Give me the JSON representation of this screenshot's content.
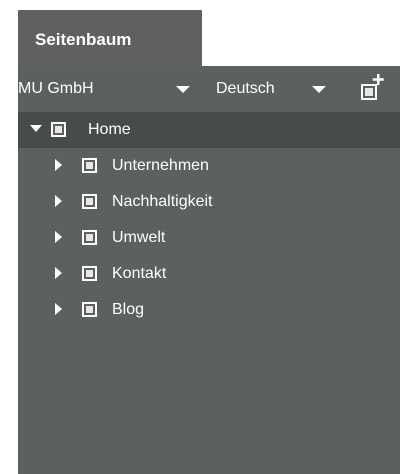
{
  "panel": {
    "title": "Seitenbaum"
  },
  "toolbar": {
    "company": "MU GmbH",
    "language": "Deutsch",
    "add_page_icon": "add-page-icon"
  },
  "tree": {
    "root": {
      "label": "Home",
      "expanded": true,
      "selected": true
    },
    "children": [
      {
        "label": "Unternehmen",
        "expanded": false
      },
      {
        "label": "Nachhaltigkeit",
        "expanded": false
      },
      {
        "label": "Umwelt",
        "expanded": false
      },
      {
        "label": "Kontakt",
        "expanded": false
      },
      {
        "label": "Blog",
        "expanded": false
      }
    ]
  },
  "colors": {
    "panel_bg": "#5d6060",
    "selected_row_bg": "#484b4b",
    "text": "#ffffff"
  }
}
